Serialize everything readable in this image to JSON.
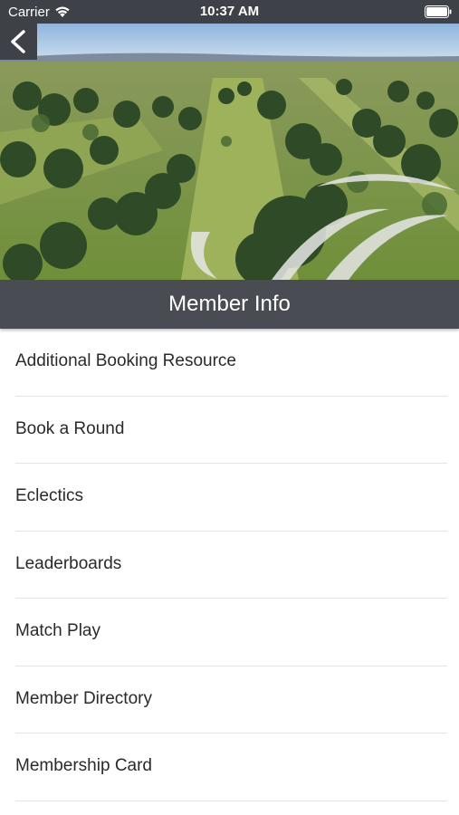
{
  "status_bar": {
    "carrier": "Carrier",
    "time": "10:37 AM",
    "wifi_icon": "wifi-icon",
    "battery_icon": "battery-icon"
  },
  "header": {
    "back_icon": "chevron-left-icon",
    "hero_image": "golf-course-aerial-photo",
    "title": "Member Info"
  },
  "menu": {
    "items": [
      {
        "label": "Additional Booking Resource"
      },
      {
        "label": "Book a Round"
      },
      {
        "label": "Eclectics"
      },
      {
        "label": "Leaderboards"
      },
      {
        "label": "Match Play"
      },
      {
        "label": "Member Directory"
      },
      {
        "label": "Membership Card"
      }
    ]
  },
  "colors": {
    "status_bar": "#3f4148",
    "title_bar": "#4a4c54",
    "text": "#2a2a2a",
    "separator": "#e4e4e6"
  }
}
